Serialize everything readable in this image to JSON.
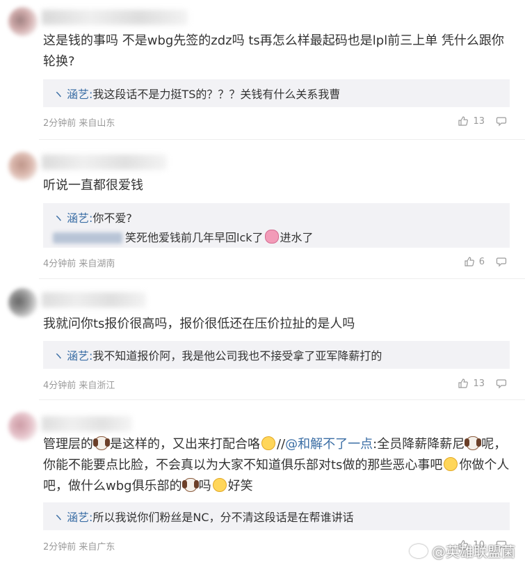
{
  "comments": [
    {
      "text": "这是钱的事吗 不是wbg先签的zdz吗 ts再怎么样最起码也是lpl前三上单 凭什么跟你轮换?",
      "reply": {
        "author": "涵艺",
        "text": "我这段话不是力挺TS的？？？关钱有什么关系我曹"
      },
      "meta": "2分钟前 来自山东",
      "likes": "13"
    },
    {
      "text": "听说一直都很爱钱",
      "reply": {
        "author": "涵艺",
        "text": "你不爱?",
        "sub_text_a": "笑死他爱钱前几年早回lck了",
        "sub_text_b": "进水了"
      },
      "meta": "4分钟前 来自湖南",
      "likes": "6"
    },
    {
      "text": "我就问你ts报价很高吗，报价很低还在压价拉扯的是人吗",
      "reply": {
        "author": "涵艺",
        "text": "我不知道报价阿，我是他公司我也不接受拿了亚军降薪打的"
      },
      "meta": "4分钟前 来自浙江",
      "likes": "13"
    },
    {
      "text_p1": "管理层的",
      "text_p2": "是这样的，又出来打配合咯",
      "text_p3": "//",
      "mention": "@和解不了一点",
      "text_p4": ":全员降薪降薪尼",
      "text_p5": "呢，你能不能要点比脸，不会真以为大家不知道俱乐部对ts做的那些恶心事吧",
      "text_p6": "你做个人吧，做什么wbg俱乐部的",
      "text_p7": "吗",
      "text_p8": "好笑",
      "reply": {
        "author": "涵艺",
        "text": "所以我说你们粉丝是NC，分不清这段话是在帮谁讲话"
      },
      "meta": "2分钟前 来自广东",
      "likes": "10"
    }
  ],
  "reply_tick": "ヽ",
  "reply_sep": ":",
  "watermark": "@英雄联盟菌",
  "colors": {
    "link": "#3b6ea5",
    "meta": "#9a9a9a",
    "reply_bg": "#f2f2f5"
  }
}
